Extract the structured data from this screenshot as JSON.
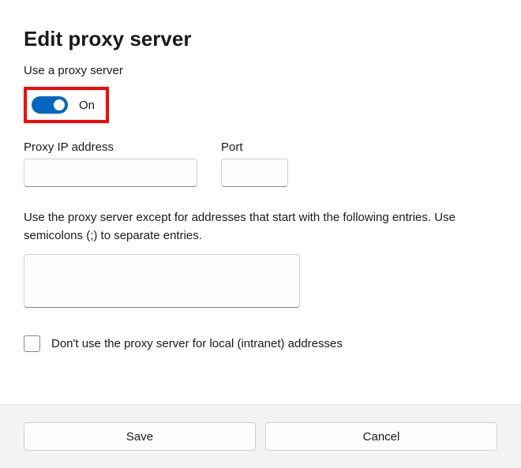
{
  "title": "Edit proxy server",
  "useProxyLabel": "Use a proxy server",
  "toggle": {
    "state": "On",
    "on": true
  },
  "fields": {
    "ipLabel": "Proxy IP address",
    "ipValue": "",
    "portLabel": "Port",
    "portValue": ""
  },
  "exceptionText": "Use the proxy server except for addresses that start with the following entries. Use semicolons (;) to separate entries.",
  "exceptionsValue": "",
  "checkbox": {
    "label": "Don't use the proxy server for local (intranet) addresses",
    "checked": false
  },
  "buttons": {
    "save": "Save",
    "cancel": "Cancel"
  }
}
